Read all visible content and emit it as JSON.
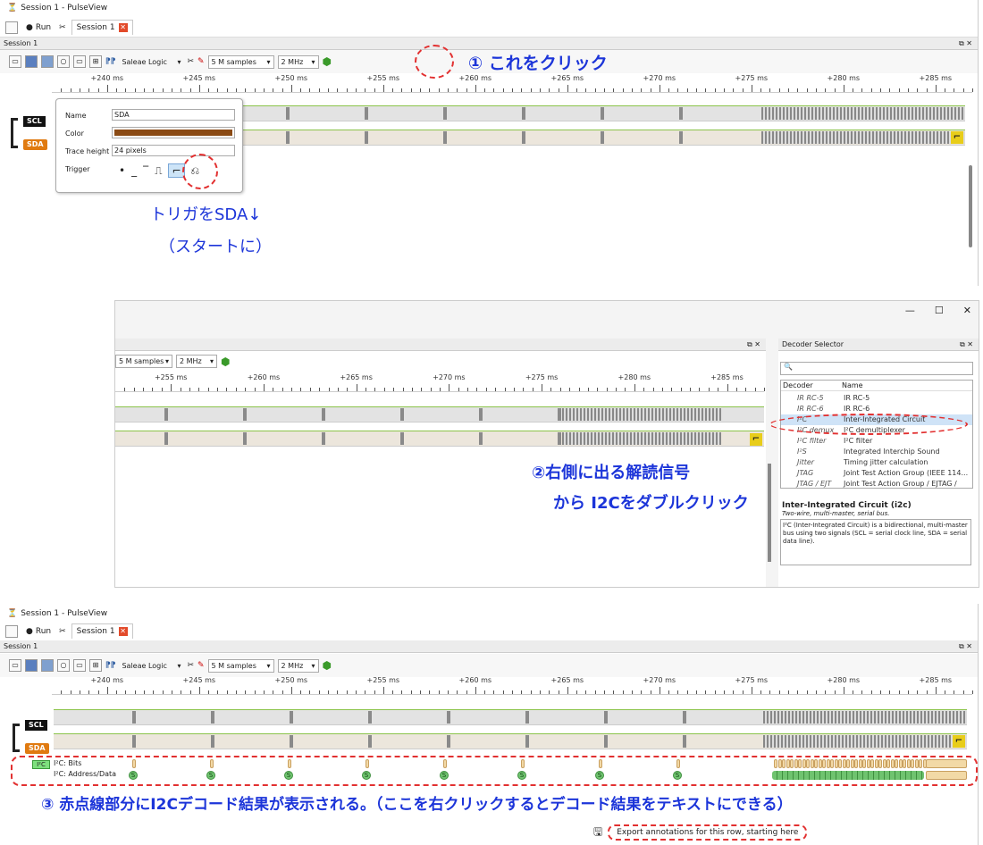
{
  "window_title": "Session 1 - PulseView",
  "menubar": {
    "run_label": "Run",
    "session_tab": "Session 1"
  },
  "session_bar": {
    "label": "Session 1",
    "dock_icons": "⧉ ✕"
  },
  "toolbar": {
    "device": "Saleae Logic",
    "samples": "5 M samples",
    "rate": "2 MHz"
  },
  "ruler_labels": [
    "+240 ms",
    "+245 ms",
    "+250 ms",
    "+255 ms",
    "+260 ms",
    "+265 ms",
    "+270 ms",
    "+275 ms",
    "+280 ms",
    "+285 ms"
  ],
  "ruler_labels_mid": [
    "+255 ms",
    "+260 ms",
    "+265 ms",
    "+270 ms",
    "+275 ms",
    "+280 ms",
    "+285 ms"
  ],
  "channels": {
    "scl": "SCL",
    "sda": "SDA"
  },
  "popup": {
    "name_label": "Name",
    "name_value": "SDA",
    "color_label": "Color",
    "color_value": "#8a4a14",
    "trace_label": "Trace height",
    "trace_value": "24 pixels",
    "trigger_label": "Trigger",
    "trigger_symbols": [
      "•",
      "_",
      "‾",
      "⎍",
      "⌐",
      "⎌"
    ]
  },
  "annotations": {
    "step1": "① これをクリック",
    "trigger_note_1": "トリガをSDA↓",
    "trigger_note_2": "（スタートに）",
    "step2_line1": "②右側に出る解読信号",
    "step2_line2": "から I2Cをダブルクリック",
    "step3": "③ 赤点線部分にI2Cデコード結果が表示される。（ここを右クリックするとデコード結果をテキストにできる）"
  },
  "window_controls": {
    "minimize": "—",
    "maximize": "☐",
    "close": "✕"
  },
  "decoder_selector": {
    "title": "Decoder Selector",
    "col_decoder": "Decoder",
    "col_name": "Name",
    "rows": [
      {
        "id": "IR RC-5",
        "name": "IR RC-5"
      },
      {
        "id": "IR RC-6",
        "name": "IR RC-6"
      },
      {
        "id": "I²C",
        "name": "Inter-Integrated Circuit"
      },
      {
        "id": "I²C demux",
        "name": "I²C demultiplexer"
      },
      {
        "id": "I²C filter",
        "name": "I²C filter"
      },
      {
        "id": "I²S",
        "name": "Integrated Interchip Sound"
      },
      {
        "id": "Jitter",
        "name": "Timing jitter calculation"
      },
      {
        "id": "JTAG",
        "name": "Joint Test Action Group (IEEE 114..."
      },
      {
        "id": "JTAG / EJT",
        "name": "Joint Test Action Group / EJTAG /"
      }
    ],
    "desc_title": "Inter-Integrated Circuit (i2c)",
    "desc_sub": "Two-wire, multi-master, serial bus.",
    "desc_body": "I²C (Inter-Integrated Circuit) is a bidirectional, multi-master bus using two signals (SCL = serial clock line, SDA = serial data line)."
  },
  "decode_rows": {
    "badge": "I²C",
    "bits": "I²C: Bits",
    "addr": "I²C: Address/Data",
    "start_glyph": "S"
  },
  "context_menu": {
    "export": "Export annotations for this row, starting here"
  },
  "colors": {
    "accent_blue": "#1c35d9",
    "red_dash": "#e23030",
    "sda_orange": "#e07a10"
  }
}
